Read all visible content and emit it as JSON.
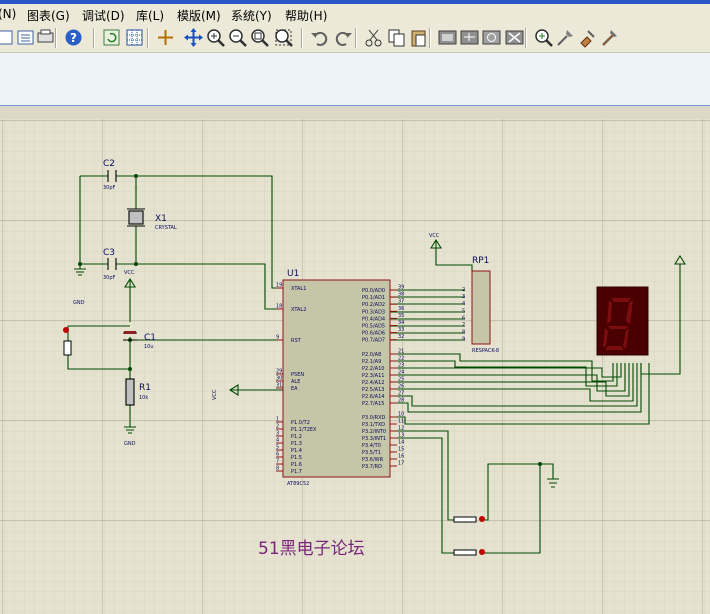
{
  "menu": [
    "(N)",
    "图表(G)",
    "调试(D)",
    "库(L)",
    "模版(M)",
    "系统(Y)",
    "帮助(H)"
  ],
  "toolbar_icons": [
    "toolbar-doc-icon",
    "toolbar-list-icon",
    "toolbar-print-icon",
    "help-icon",
    "refresh-icon",
    "grid-icon",
    "origin-icon",
    "pan-icon",
    "zoom-in-icon",
    "zoom-out-icon",
    "zoom-all-icon",
    "zoom-area-icon",
    "undo-icon",
    "redo-icon",
    "cut-icon",
    "copy-icon",
    "paste-icon",
    "block-copy-icon",
    "block-move-icon",
    "block-rotate-icon",
    "block-delete-icon",
    "pick-device-icon",
    "make-device-icon",
    "packaging-icon",
    "decompose-icon"
  ],
  "schematic": {
    "c2": {
      "ref": "C2",
      "value": "30pF"
    },
    "c3": {
      "ref": "C3",
      "value": "30pF"
    },
    "x1": {
      "ref": "X1",
      "value": "CRYSTAL"
    },
    "c1": {
      "ref": "C1",
      "value": "10u"
    },
    "r1": {
      "ref": "R1",
      "value": "10k"
    },
    "gnd": "GND",
    "vcc": "VCC",
    "u1": {
      "ref": "U1",
      "part": "AT89C52",
      "left_pins": [
        {
          "num": "19",
          "name": "XTAL1"
        },
        {
          "num": "18",
          "name": "XTAL2"
        },
        {
          "num": "9",
          "name": "RST"
        },
        {
          "num": "29",
          "name": "PSEN"
        },
        {
          "num": "30",
          "name": "ALE"
        },
        {
          "num": "31",
          "name": "EA"
        },
        {
          "num": "1",
          "name": "P1.0/T2"
        },
        {
          "num": "2",
          "name": "P1.1/T2EX"
        },
        {
          "num": "3",
          "name": "P1.2"
        },
        {
          "num": "4",
          "name": "P1.3"
        },
        {
          "num": "5",
          "name": "P1.4"
        },
        {
          "num": "6",
          "name": "P1.5"
        },
        {
          "num": "7",
          "name": "P1.6"
        },
        {
          "num": "8",
          "name": "P1.7"
        }
      ],
      "right_pins": [
        {
          "num": "39",
          "name": "P0.0/AD0"
        },
        {
          "num": "38",
          "name": "P0.1/AD1"
        },
        {
          "num": "37",
          "name": "P0.2/AD2"
        },
        {
          "num": "36",
          "name": "P0.3/AD3"
        },
        {
          "num": "35",
          "name": "P0.4/AD4"
        },
        {
          "num": "34",
          "name": "P0.5/AD5"
        },
        {
          "num": "33",
          "name": "P0.6/AD6"
        },
        {
          "num": "32",
          "name": "P0.7/AD7"
        },
        {
          "num": "21",
          "name": "P2.0/A8"
        },
        {
          "num": "22",
          "name": "P2.1/A9"
        },
        {
          "num": "23",
          "name": "P2.2/A10"
        },
        {
          "num": "24",
          "name": "P2.3/A11"
        },
        {
          "num": "25",
          "name": "P2.4/A12"
        },
        {
          "num": "26",
          "name": "P2.5/A13"
        },
        {
          "num": "27",
          "name": "P2.6/A14"
        },
        {
          "num": "28",
          "name": "P2.7/A15"
        },
        {
          "num": "10",
          "name": "P3.0/RXD"
        },
        {
          "num": "11",
          "name": "P3.1/TXD"
        },
        {
          "num": "12",
          "name": "P3.2/INT0"
        },
        {
          "num": "13",
          "name": "P3.3/INT1"
        },
        {
          "num": "14",
          "name": "P3.4/T0"
        },
        {
          "num": "15",
          "name": "P3.5/T1"
        },
        {
          "num": "16",
          "name": "P3.6/WR"
        },
        {
          "num": "17",
          "name": "P3.7/RD"
        }
      ]
    },
    "rp1": {
      "ref": "RP1",
      "part": "RESPACK-8",
      "pins": [
        "2",
        "3",
        "4",
        "5",
        "6",
        "7",
        "8",
        "9"
      ]
    },
    "watermark": "51黑电子论坛"
  },
  "colors": {
    "grid_bg": "#e5e3d0",
    "wire": "#004a00",
    "body": "#c5c5a7",
    "body_border": "#8f1414",
    "pin": "#8f1414",
    "label": "#0b0b60",
    "display_bg": "#4a0000",
    "segment": "#7a0e0e",
    "watermark": "#7a247a"
  }
}
